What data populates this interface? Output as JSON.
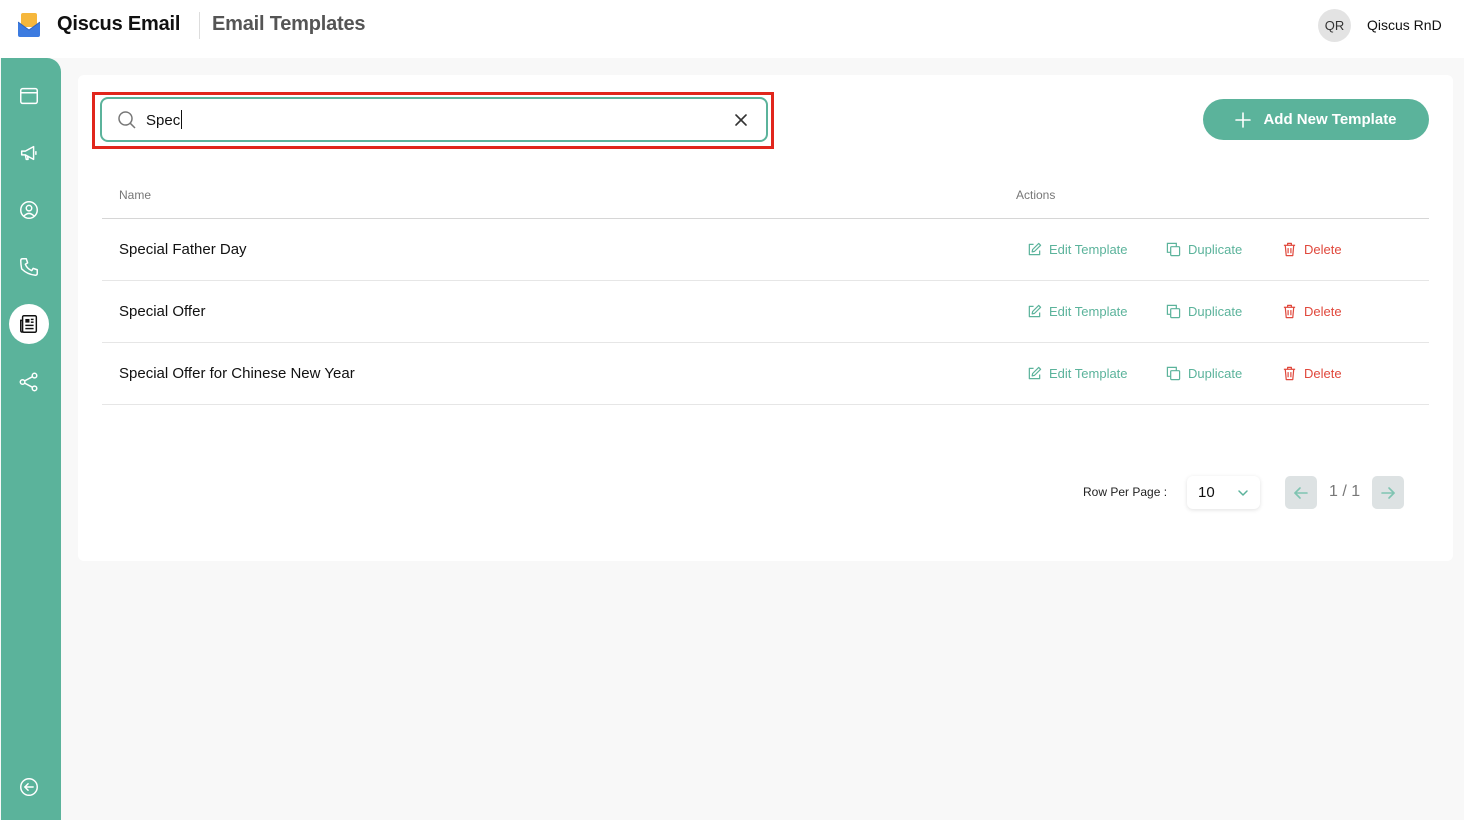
{
  "header": {
    "app_name": "Qiscus Email",
    "page_title": "Email Templates",
    "avatar_initials": "QR",
    "user_name": "Qiscus RnD"
  },
  "sidebar": {
    "items": [
      {
        "icon": "browser-window-icon",
        "active": false
      },
      {
        "icon": "megaphone-icon",
        "active": false
      },
      {
        "icon": "user-circle-icon",
        "active": false
      },
      {
        "icon": "phone-icon",
        "active": false
      },
      {
        "icon": "newspaper-icon",
        "active": true
      },
      {
        "icon": "share-nodes-icon",
        "active": false
      }
    ],
    "collapse_icon": "arrow-left-circle-icon"
  },
  "search": {
    "value": "Spec",
    "placeholder": ""
  },
  "toolbar": {
    "add_label": "Add New Template"
  },
  "table": {
    "columns": [
      "Name",
      "Actions"
    ],
    "rows": [
      {
        "name": "Special Father Day"
      },
      {
        "name": "Special Offer"
      },
      {
        "name": "Special Offer for Chinese New Year"
      }
    ],
    "actions": {
      "edit": "Edit Template",
      "duplicate": "Duplicate",
      "delete": "Delete"
    }
  },
  "pagination": {
    "rows_per_page_label": "Row Per Page :",
    "rows_per_page_value": "10",
    "page_info": "1 / 1"
  },
  "colors": {
    "accent": "#5bb39b",
    "danger": "#e0483c",
    "highlight": "#e1261c"
  }
}
